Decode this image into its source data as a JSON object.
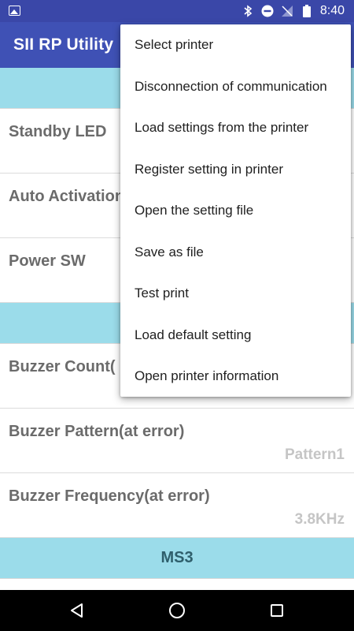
{
  "status_bar": {
    "time": "8:40",
    "icons": [
      "gallery-icon",
      "bluetooth-icon",
      "do-not-disturb-icon",
      "no-signal-icon",
      "battery-icon"
    ]
  },
  "app_bar": {
    "title": "SII RP Utility"
  },
  "content": {
    "section_top": {
      "label": ""
    },
    "rows_group1": [
      {
        "label": "Standby LED",
        "value": ""
      },
      {
        "label": "Auto Activation",
        "value": ""
      },
      {
        "label": "Power SW",
        "value": ""
      }
    ],
    "section_mid": {
      "label": ""
    },
    "rows_group2": [
      {
        "label": "Buzzer Count(",
        "value": ""
      },
      {
        "label": "Buzzer Pattern(at error)",
        "value": "Pattern1"
      },
      {
        "label": "Buzzer Frequency(at error)",
        "value": "3.8KHz"
      }
    ],
    "section_bottom": {
      "label": "MS3"
    }
  },
  "overflow_menu": {
    "items": [
      "Select printer",
      "Disconnection of communication",
      "Load settings from the printer",
      "Register setting in printer",
      "Open the setting file",
      "Save as file",
      "Test print",
      "Load default setting",
      "Open printer information"
    ]
  },
  "nav_bar": {
    "buttons": [
      "back-icon",
      "home-icon",
      "recents-icon"
    ]
  }
}
